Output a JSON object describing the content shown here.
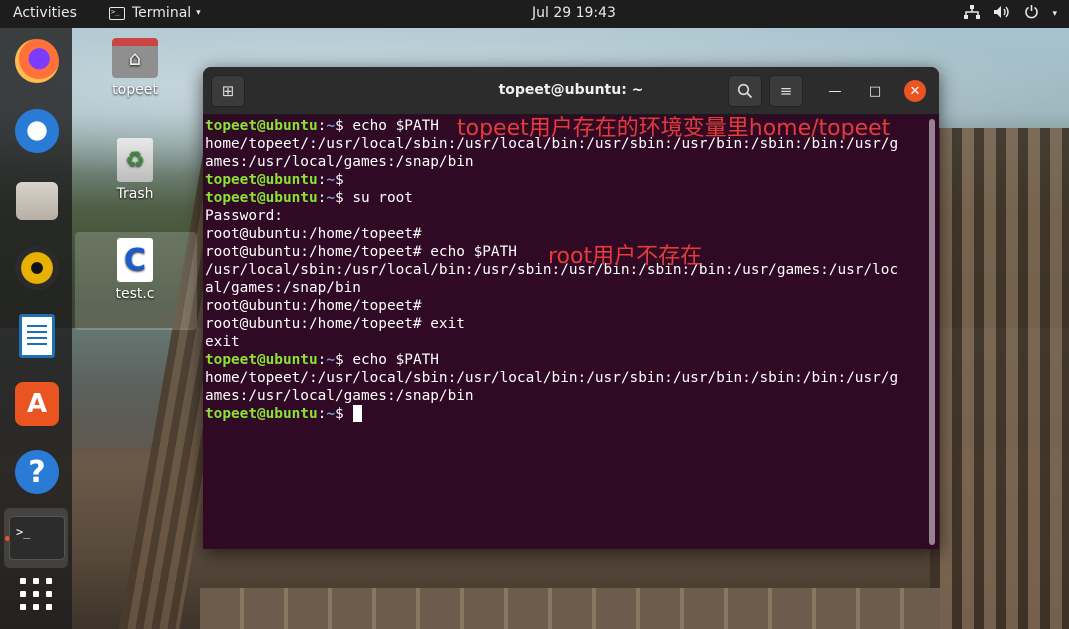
{
  "top_bar": {
    "activities": "Activities",
    "app_name": "Terminal",
    "app_caret": "▾",
    "clock": "Jul 29  19:43",
    "tray": {
      "network_icon": "network-icon",
      "volume_icon": "volume-icon",
      "power_icon": "power-icon",
      "menu_caret": "▾"
    }
  },
  "dock": {
    "apps": [
      "firefox",
      "thunderbird",
      "files",
      "rhythmbox",
      "libreoffice-writer",
      "software-center",
      "help",
      "terminal"
    ],
    "store_glyph": "A",
    "help_glyph": "?",
    "terminal_glyph": ">_"
  },
  "desktop": {
    "icons": [
      {
        "label": "topeet",
        "icon": "home-folder-icon",
        "glyph": "⌂"
      },
      {
        "label": "Trash",
        "icon": "trash-icon",
        "glyph": "♻"
      },
      {
        "label": "test.c",
        "icon": "c-file-icon",
        "glyph": "C"
      }
    ]
  },
  "terminal": {
    "title": "topeet@ubuntu: ~",
    "new_tab_glyph": "⊞",
    "search_glyph": "⚲",
    "menu_glyph": "≡",
    "minimize_glyph": "—",
    "maximize_glyph": "□",
    "close_glyph": "✕",
    "prompt_user": "topeet@ubuntu",
    "prompt_sep": ":",
    "prompt_dir": "~",
    "prompt_end": "$ ",
    "lines": [
      {
        "type": "prompt",
        "cmd": "echo $PATH"
      },
      {
        "type": "out",
        "text": "home/topeet/:/usr/local/sbin:/usr/local/bin:/usr/sbin:/usr/bin:/sbin:/bin:/usr/g"
      },
      {
        "type": "out",
        "text": "ames:/usr/local/games:/snap/bin"
      },
      {
        "type": "prompt",
        "cmd": ""
      },
      {
        "type": "prompt",
        "cmd": "su root"
      },
      {
        "type": "out",
        "text": "Password:"
      },
      {
        "type": "out",
        "text": "root@ubuntu:/home/topeet#"
      },
      {
        "type": "out",
        "text": "root@ubuntu:/home/topeet# echo $PATH"
      },
      {
        "type": "out",
        "text": "/usr/local/sbin:/usr/local/bin:/usr/sbin:/usr/bin:/sbin:/bin:/usr/games:/usr/loc"
      },
      {
        "type": "out",
        "text": "al/games:/snap/bin"
      },
      {
        "type": "out",
        "text": "root@ubuntu:/home/topeet#"
      },
      {
        "type": "out",
        "text": "root@ubuntu:/home/topeet# exit"
      },
      {
        "type": "out",
        "text": "exit"
      },
      {
        "type": "prompt",
        "cmd": "echo $PATH"
      },
      {
        "type": "out",
        "text": "home/topeet/:/usr/local/sbin:/usr/local/bin:/usr/sbin:/usr/bin:/sbin:/bin:/usr/g"
      },
      {
        "type": "out",
        "text": "ames:/usr/local/games:/snap/bin"
      },
      {
        "type": "prompt",
        "cmd": "",
        "cursor": true
      }
    ],
    "annotations": {
      "topeet_note": "topeet用户存在的环境变量里home/topeet",
      "root_note": "root用户不存在"
    }
  },
  "colors": {
    "terminal_bg": "#300a24",
    "prompt_user": "#8ae234",
    "prompt_dir": "#729fcf",
    "annotation": "#e53b3b",
    "ubuntu_orange": "#e95420"
  }
}
